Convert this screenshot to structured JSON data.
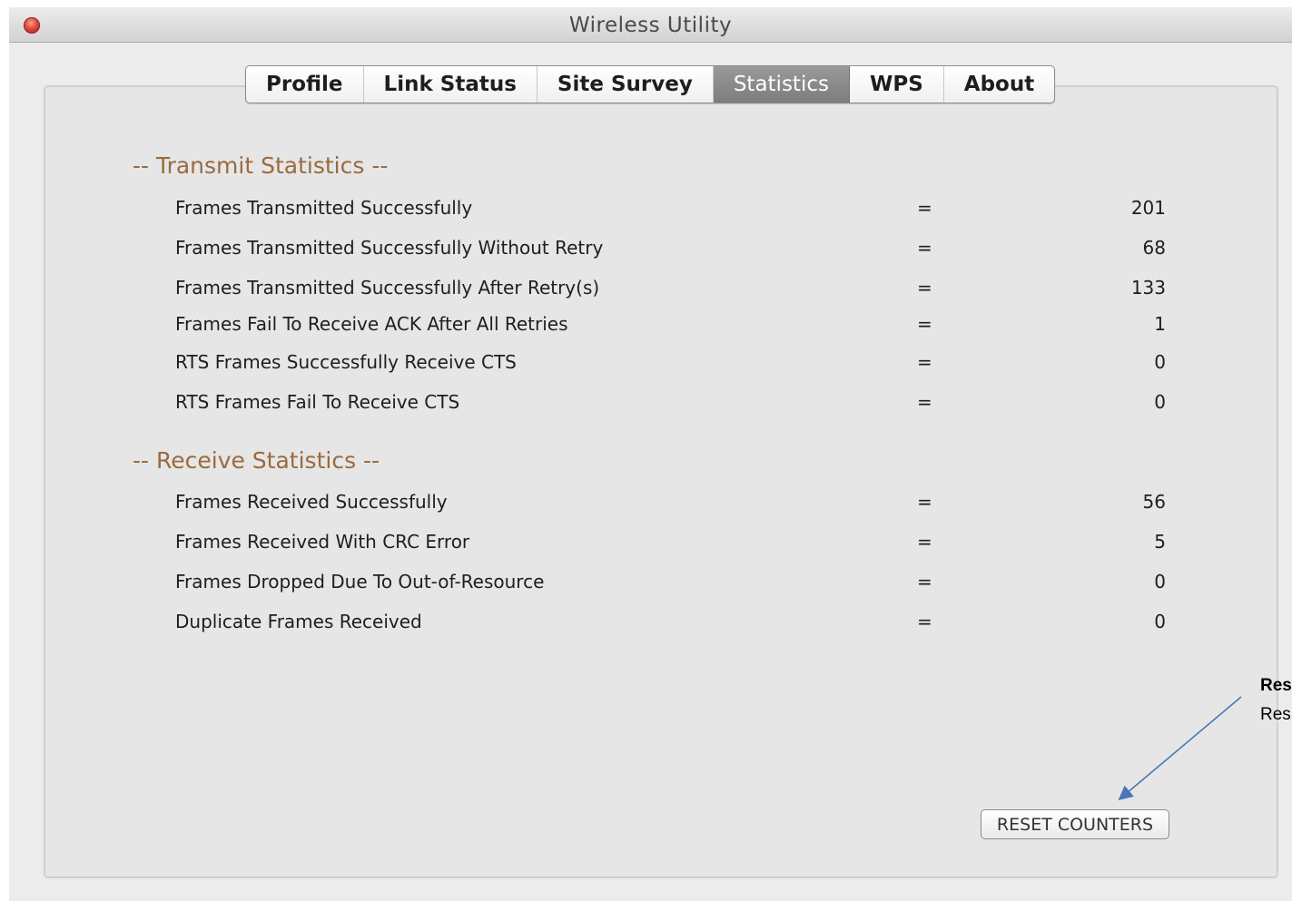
{
  "window": {
    "title": "Wireless Utility"
  },
  "tabs": [
    {
      "label": "Profile"
    },
    {
      "label": "Link Status"
    },
    {
      "label": "Site Survey"
    },
    {
      "label": "Statistics"
    },
    {
      "label": "WPS"
    },
    {
      "label": "About"
    }
  ],
  "active_tab": "Statistics",
  "transmit": {
    "title": "-- Transmit Statistics --",
    "rows": [
      {
        "label": "Frames Transmitted Successfully",
        "eq": "=",
        "value": "201"
      },
      {
        "label": "Frames Transmitted Successfully Without Retry",
        "eq": "=",
        "value": "68"
      },
      {
        "label": "Frames Transmitted Successfully After Retry(s)",
        "eq": "=",
        "value": "133"
      },
      {
        "label": "Frames Fail To Receive ACK After All Retries",
        "eq": "=",
        "value": "1"
      },
      {
        "label": "RTS Frames Successfully Receive CTS",
        "eq": "=",
        "value": "0"
      },
      {
        "label": "RTS Frames Fail To Receive CTS",
        "eq": "=",
        "value": "0"
      }
    ]
  },
  "receive": {
    "title": "-- Receive Statistics --",
    "rows": [
      {
        "label": "Frames Received Successfully",
        "eq": "=",
        "value": "56"
      },
      {
        "label": "Frames Received With CRC Error",
        "eq": "=",
        "value": "5"
      },
      {
        "label": "Frames Dropped Due To Out-of-Resource",
        "eq": "=",
        "value": "0"
      },
      {
        "label": "Duplicate Frames Received",
        "eq": "=",
        "value": "0"
      }
    ]
  },
  "reset_button": {
    "label": "RESET COUNTERS"
  },
  "annotation": {
    "title": "Res",
    "body": "Res"
  },
  "colors": {
    "section_title": "#9a6b3e",
    "active_tab_bg": "#8a8a8a",
    "arrow": "#4a76b8"
  }
}
